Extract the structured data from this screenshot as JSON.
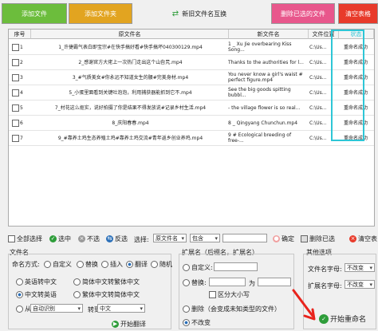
{
  "toolbar": {
    "add_file": "添加文件",
    "add_folder": "添加文件夹",
    "swap": "新旧文件名互换",
    "delete_selected": "删除已选的文件",
    "clear": "清空表格"
  },
  "table": {
    "headers": [
      "序号",
      "原文件名",
      "新文件名",
      "文件位置",
      "状态"
    ],
    "rows": [
      {
        "num": "1",
        "orig": "1_许捷霸气表白即宝宗#在快手搞好看#快手搞坏040300129.mp4",
        "new": "1 _ Xu Jie overbearing Kiss Song...",
        "loc": "C:\\Us...",
        "status": "重命名成功"
      },
      {
        "num": "2",
        "orig": "2_感谢官方大佬上一次热门走出这个山旮旯.mp4",
        "new": "Thanks to the authorities for l...",
        "loc": "C:\\Us...",
        "status": "重命名成功"
      },
      {
        "num": "3",
        "orig": "3_#气质美女#你永远不知道女生的腰#完美身材.mp4",
        "new": "You never know a girl's waist # perfect figure.mp4",
        "loc": "C:\\Us...",
        "status": "重命名成功"
      },
      {
        "num": "4",
        "orig": "5_小蛋里面看到关键吐泡泡，利用捕获器能抓到它不.mp4",
        "new": "See the big goods spitting bubbl...",
        "loc": "C:\\Us...",
        "status": "重命名成功"
      },
      {
        "num": "5",
        "orig": "7_村花这么抠实，说好拍摄了你是结果不得发放说#记录乡村生活.mp4",
        "new": "- the village flower is so real...",
        "loc": "C:\\Us...",
        "status": "重命名成功"
      },
      {
        "num": "6",
        "orig": "8_庆阳春春.mp4",
        "new": "8 _ Qingyang Chunchun.mp4",
        "loc": "C:\\Us...",
        "status": "重命名成功"
      },
      {
        "num": "7",
        "orig": "9_#靠养土鸡生态养殖土鸡#靠养土鸡交流#青年返乡创业养鸡.mp4",
        "new": "9 # Ecological breeding of free-...",
        "loc": "C:\\Us...",
        "status": "重命名成功"
      }
    ]
  },
  "selection": {
    "select_all": "全部选择",
    "select": "选中",
    "unselect": "不选",
    "invert": "反选",
    "choose_label": "选择:",
    "choose_field": "原文件名",
    "choose_op": "包含",
    "confirm": "确定",
    "delete_selected": "删除已选",
    "clear": "清空表"
  },
  "filename": {
    "title": "文件名",
    "naming_mode": "命名方式:",
    "custom": "自定义",
    "replace": "替换",
    "insert": "插入",
    "translate": "翻译",
    "random": "随机",
    "en_to_cn": "英语转中文",
    "simp_to_trad": "简体中文转繁体中文",
    "cn_to_en": "中文转英语",
    "trad_to_simp": "繁体中文转简体中文",
    "from_label": "从",
    "from_value": "自动识别",
    "to_label": "转到",
    "to_value": "中文",
    "start_translate": "开始翻译"
  },
  "extension": {
    "title": "扩展名（后缀名，扩展名）",
    "custom": "自定义:",
    "replace": "替换:",
    "to_label": "为",
    "case_sensitive": "区分大小写",
    "delete": "删除（会变成未知类型的文件）",
    "no_change": "不改变"
  },
  "other": {
    "title": "其他选项",
    "name_case": "文件名字母:",
    "name_case_value": "不改变",
    "ext_case": "扩展名字母:",
    "ext_case_value": "不改变",
    "start": "开始重命名"
  },
  "colors": {
    "add_file": "#6cbd3c",
    "add_folder": "#e2a420",
    "delete_selected": "#e8578c",
    "clear": "#e83a2a",
    "highlight": "#2ec6d6",
    "annotation": "#e8231c"
  }
}
